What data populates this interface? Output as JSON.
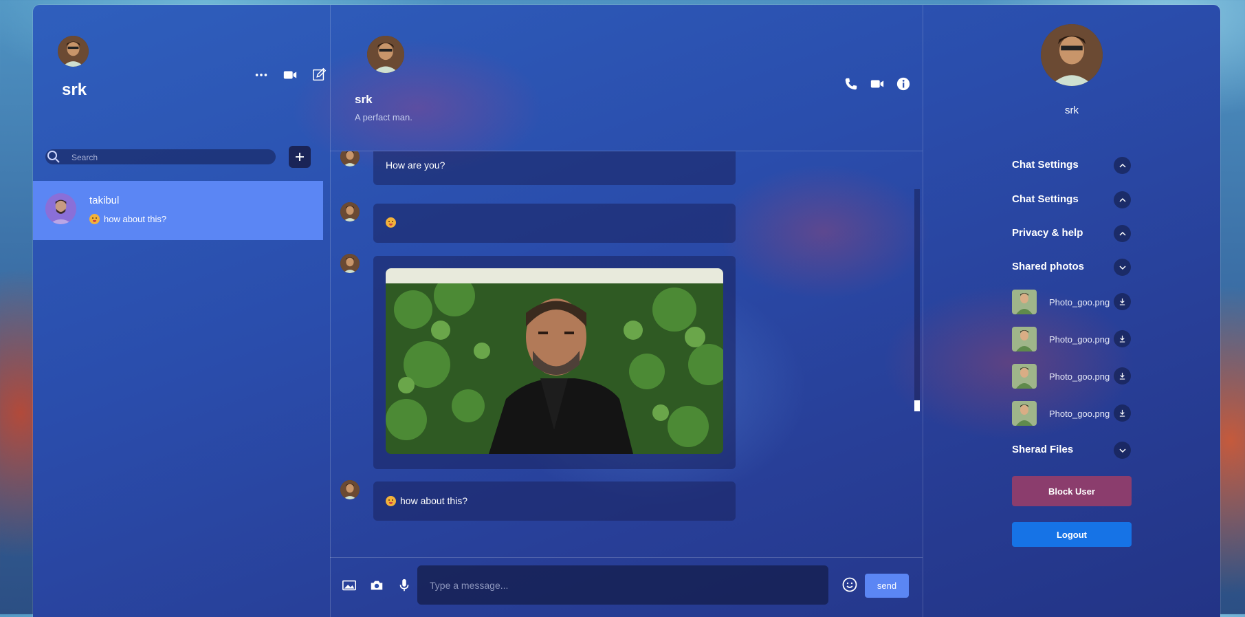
{
  "left": {
    "user_name": "srk",
    "search_placeholder": "Search",
    "chats": [
      {
        "name": "takibul",
        "last_message": "how about this?"
      }
    ]
  },
  "chat": {
    "name": "srk",
    "status": "A perfact man.",
    "messages": [
      {
        "type": "text",
        "text": "How are you?"
      },
      {
        "type": "emoji",
        "text": ""
      },
      {
        "type": "image",
        "text": ""
      },
      {
        "type": "text",
        "text": "how about this?"
      }
    ],
    "input_placeholder": "Type a message...",
    "send_label": "send"
  },
  "details": {
    "name": "srk",
    "sections": [
      {
        "label": "Chat Settings",
        "expanded": false
      },
      {
        "label": "Chat Settings",
        "expanded": false
      },
      {
        "label": "Privacy & help",
        "expanded": false
      },
      {
        "label": "Shared photos",
        "expanded": true
      },
      {
        "label": "Sherad Files",
        "expanded": true
      }
    ],
    "shared_photos": [
      "Photo_goo.png",
      "Photo_goo.png",
      "Photo_goo.png",
      "Photo_goo.png"
    ],
    "block_label": "Block User",
    "logout_label": "Logout"
  },
  "icons": {
    "more": "more-dots-icon",
    "video": "video-camera-icon",
    "edit": "edit-icon",
    "search": "search-icon",
    "add": "plus-icon",
    "phone": "phone-icon",
    "info": "info-icon",
    "image": "image-icon",
    "camera": "camera-icon",
    "mic": "microphone-icon",
    "emoji": "emoji-icon",
    "chevron_up": "chevron-up-icon",
    "chevron_down": "chevron-down-icon",
    "download": "download-icon"
  },
  "colors": {
    "accent": "#5b86f4",
    "block": "#8b3d6d",
    "logout": "#1673e6"
  }
}
